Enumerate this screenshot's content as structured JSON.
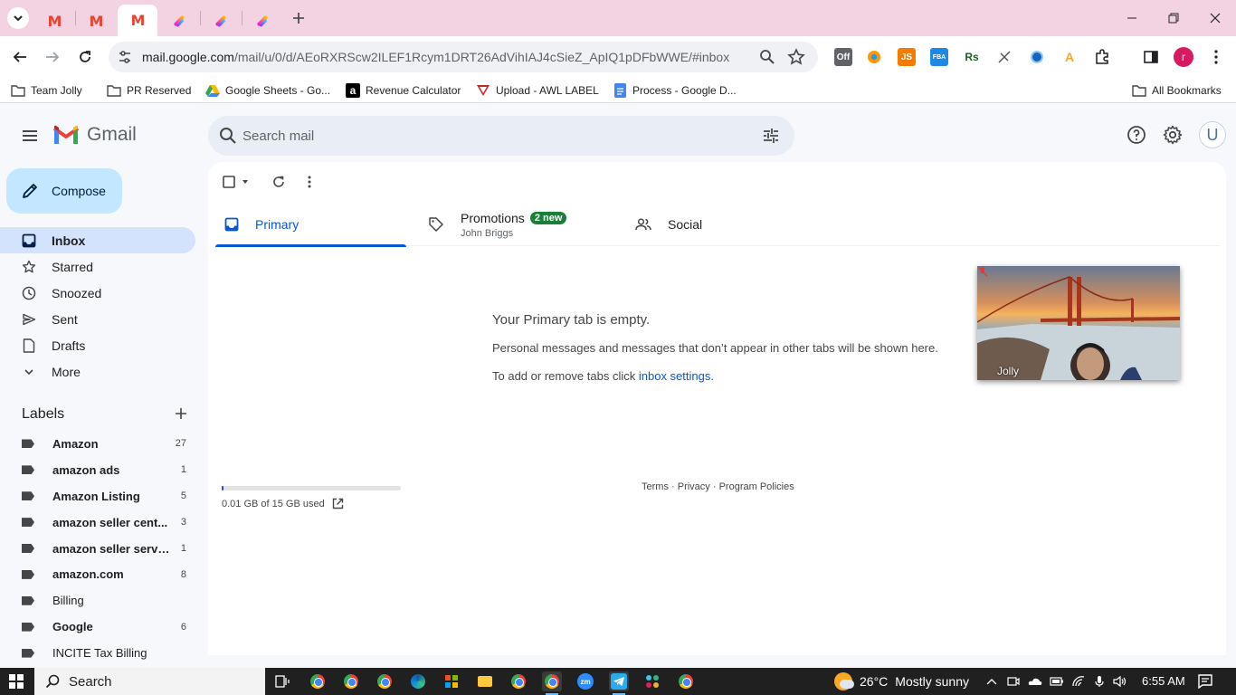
{
  "browser": {
    "tabs": [
      {
        "icon": "gmail-icon",
        "active": false
      },
      {
        "icon": "gmail-icon",
        "active": false
      },
      {
        "icon": "gmail-icon",
        "active": true
      },
      {
        "icon": "clickup-icon",
        "active": false
      },
      {
        "icon": "clickup-icon",
        "active": false
      },
      {
        "icon": "clickup-icon",
        "active": false
      }
    ],
    "url_host": "mail.google.com",
    "url_path": "/mail/u/0/d/AEoRXRScw2ILEF1Rcym1DRT26AdVihIAJ4cSieZ_ApIQ1pDFbWWE/#inbox",
    "extensions": [
      {
        "icon": "coupon-off-icon",
        "text": "Off"
      },
      {
        "icon": "orange-circle-icon",
        "text": ""
      },
      {
        "icon": "js-icon",
        "text": "JS"
      },
      {
        "icon": "fba-icon",
        "text": "FBA"
      },
      {
        "icon": "rs-icon",
        "text": "Rs"
      },
      {
        "icon": "satellite-icon",
        "text": ""
      },
      {
        "icon": "globe-icon",
        "text": ""
      },
      {
        "icon": "account-icon",
        "text": "A"
      },
      {
        "icon": "puzzle-icon",
        "text": ""
      }
    ],
    "profile_initial": "r",
    "bookmarks": [
      {
        "icon": "folder-icon",
        "label": "Team Jolly"
      },
      {
        "icon": "folder-icon",
        "label": "PR Reserved"
      },
      {
        "icon": "google-drive-icon",
        "label": "Google Sheets - Go..."
      },
      {
        "icon": "amazon-icon",
        "label": "Revenue Calculator"
      },
      {
        "icon": "awl-icon",
        "label": "Upload - AWL LABEL"
      },
      {
        "icon": "google-docs-icon",
        "label": "Process - Google D..."
      }
    ],
    "all_bookmarks": "All Bookmarks"
  },
  "gmail": {
    "brand": "Gmail",
    "search_placeholder": "Search mail",
    "avatar_initial": "U",
    "compose_label": "Compose",
    "nav": [
      {
        "icon": "inbox-icon",
        "label": "Inbox",
        "active": true
      },
      {
        "icon": "star-icon",
        "label": "Starred",
        "active": false
      },
      {
        "icon": "clock-icon",
        "label": "Snoozed",
        "active": false
      },
      {
        "icon": "send-icon",
        "label": "Sent",
        "active": false
      },
      {
        "icon": "draft-icon",
        "label": "Drafts",
        "active": false
      },
      {
        "icon": "chevron-down-icon",
        "label": "More",
        "active": false
      }
    ],
    "labels_title": "Labels",
    "labels": [
      {
        "name": "Amazon",
        "count": "27",
        "bold": true
      },
      {
        "name": "amazon ads",
        "count": "1",
        "bold": true
      },
      {
        "name": "Amazon Listing",
        "count": "5",
        "bold": true
      },
      {
        "name": "amazon seller cent...",
        "count": "3",
        "bold": true
      },
      {
        "name": "amazon seller servi...",
        "count": "1",
        "bold": true
      },
      {
        "name": "amazon.com",
        "count": "8",
        "bold": true
      },
      {
        "name": "Billing",
        "count": "",
        "bold": false
      },
      {
        "name": "Google",
        "count": "6",
        "bold": true
      },
      {
        "name": "INCITE Tax Billing",
        "count": "",
        "bold": false
      }
    ],
    "tabs": {
      "primary": "Primary",
      "promotions": "Promotions",
      "promotions_badge": "2 new",
      "promotions_sender": "John Briggs",
      "social": "Social"
    },
    "empty": {
      "title": "Your Primary tab is empty.",
      "line1": "Personal messages and messages that don’t appear in other tabs will be shown here.",
      "line2_prefix": "To add or remove tabs click ",
      "line2_link": "inbox settings",
      "line2_suffix": "."
    },
    "storage": {
      "text": "0.01 GB of 15 GB used",
      "fraction": 0.001
    },
    "footer": {
      "terms": "Terms",
      "privacy": "Privacy",
      "policies": "Program Policies"
    },
    "video_name": "Jolly"
  },
  "taskbar": {
    "search_label": "Search",
    "weather_temp": "26°C",
    "weather_desc": "Mostly sunny",
    "time": "6:55 AM"
  }
}
